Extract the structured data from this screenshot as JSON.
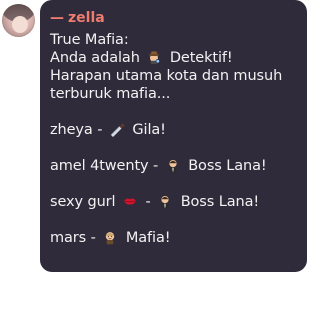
{
  "message": {
    "author": "zella",
    "author_prefix": "—",
    "accent_color": "#f07b6e",
    "bubble_color": "#2f2b3a",
    "lines": [
      {
        "text": "True Mafia:"
      },
      {
        "before": "Anda adalah",
        "emoji": "detective-emoji",
        "after": "Detektif!"
      },
      {
        "text": "Harapan utama kota dan musuh"
      },
      {
        "text": "terburuk mafia..."
      },
      {
        "gap": true
      },
      {
        "before": "zheya -",
        "emoji": "knife-emoji",
        "after": "Gila!"
      },
      {
        "gap": true
      },
      {
        "before": "amel 4twenty -",
        "emoji": "boss-emoji",
        "after": "Boss Lana!"
      },
      {
        "gap": true
      },
      {
        "before": "sexy gurl",
        "emoji": "lips-emoji",
        "mid": "-",
        "emoji2": "boss-emoji",
        "after": "Boss Lana!"
      },
      {
        "gap": true
      },
      {
        "before": "mars -",
        "emoji": "mafia-emoji",
        "after": "Mafia!"
      }
    ]
  }
}
